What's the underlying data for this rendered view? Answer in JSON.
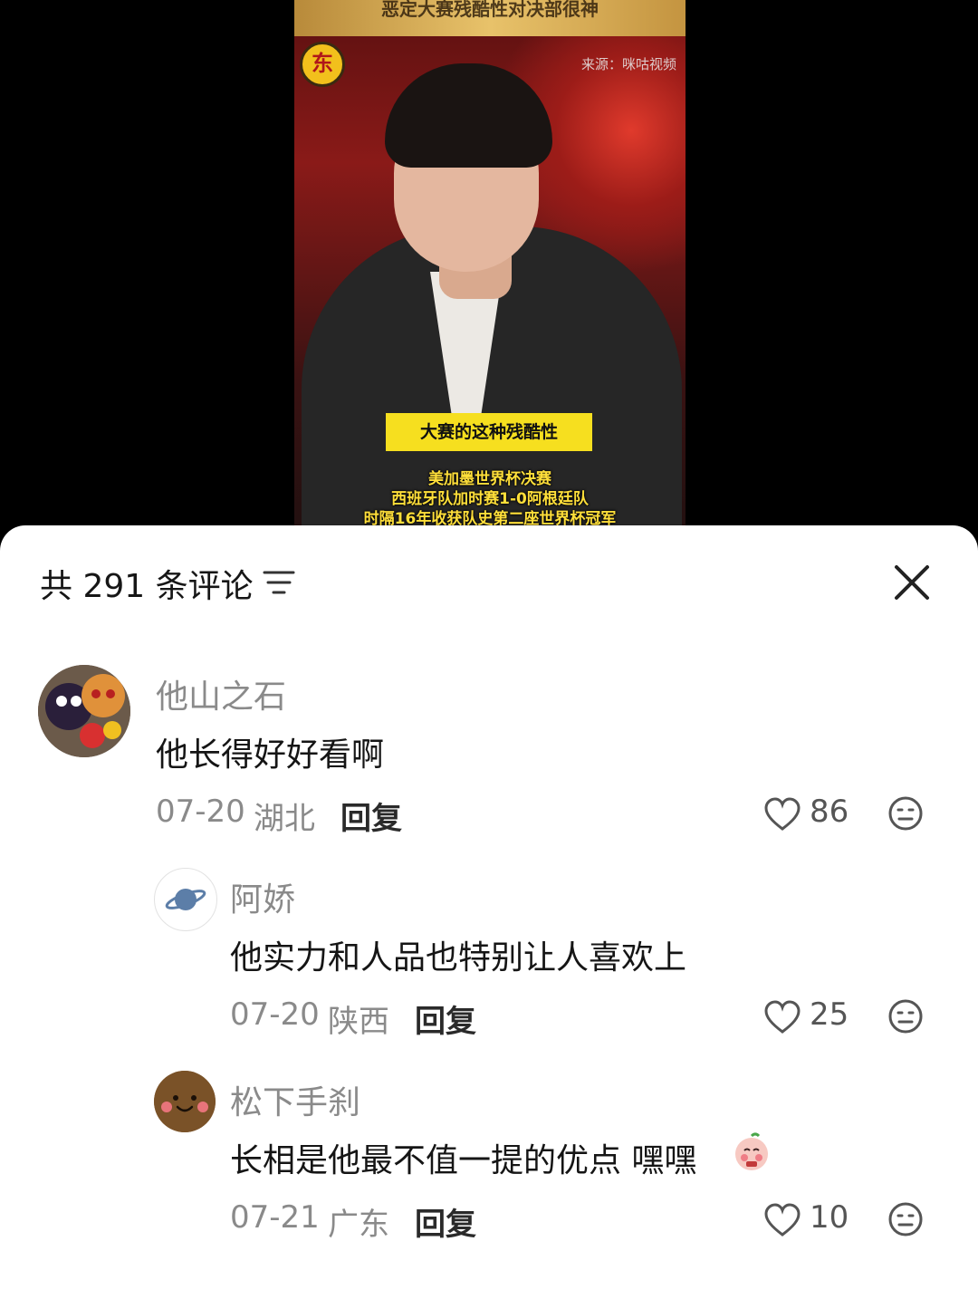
{
  "video": {
    "top_title": "恶定大赛残酷性对决部很神",
    "logo_text": "东",
    "source": "来源：咪咕视频",
    "caption_main": "大赛的这种残酷性",
    "caption_lines": [
      "美加墨世界杯决赛",
      "西班牙队加时赛1-0阿根廷队",
      "时隔16年收获队史第二座世界杯冠军"
    ]
  },
  "panel": {
    "title": "共 291 条评论"
  },
  "comments": [
    {
      "username": "他山之石",
      "content": "他长得好好看啊",
      "date": "07-20",
      "location": "湖北",
      "reply_label": "回复",
      "likes": "86"
    },
    {
      "username": "阿娇",
      "content": "他实力和人品也特别让人喜欢上",
      "date": "07-20",
      "location": "陕西",
      "reply_label": "回复",
      "likes": "25"
    },
    {
      "username": "松下手刹",
      "content": "长相是他最不值一提的优点 嘿嘿",
      "date": "07-21",
      "location": "广东",
      "reply_label": "回复",
      "likes": "10"
    }
  ],
  "colors": {
    "caption_yellow": "#f6df1f",
    "caption_text": "#ffdf3a",
    "muted_text": "#8a8a8a"
  }
}
